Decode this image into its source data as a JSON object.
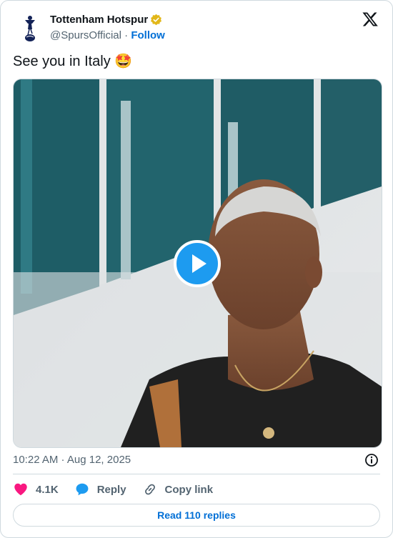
{
  "account": {
    "name": "Tottenham Hotspur",
    "handle": "@SpursOfficial",
    "separator": "·",
    "follow_label": "Follow"
  },
  "tweet": {
    "text": "See you in Italy",
    "emoji": "🤩",
    "timestamp": "10:22 AM · Aug 12, 2025"
  },
  "actions": {
    "like_count": "4.1K",
    "reply_label": "Reply",
    "copy_label": "Copy link"
  },
  "read_replies_label": "Read 110 replies",
  "colors": {
    "accent": "#1d9bf0",
    "link": "#006fd6",
    "like": "#f91880",
    "verified": "#e2b719",
    "muted": "#536471",
    "border": "#cfd9de"
  },
  "icons": [
    "spurs-crest-icon",
    "verified-badge-icon",
    "x-logo-icon",
    "play-icon",
    "info-icon",
    "heart-icon",
    "reply-bubble-icon",
    "link-icon"
  ]
}
